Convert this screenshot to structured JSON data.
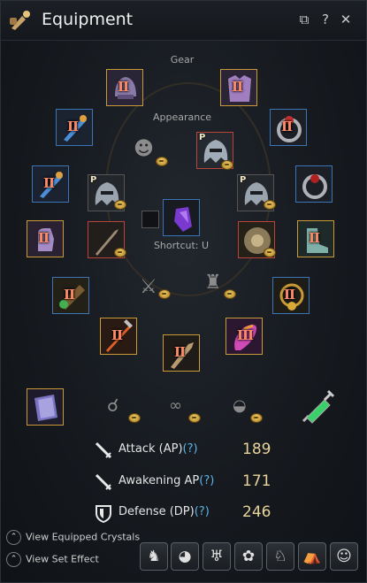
{
  "window": {
    "title": "Equipment",
    "icon": "potion-icon"
  },
  "titlebar_buttons": [
    {
      "name": "restore-icon",
      "glyph": "⧉"
    },
    {
      "name": "help-icon",
      "glyph": "?"
    },
    {
      "name": "close-icon",
      "glyph": "✕"
    }
  ],
  "labels": {
    "gear": "Gear",
    "appearance": "Appearance",
    "shortcut": "Shortcut: U"
  },
  "gear_slots": [
    {
      "id": "helmet",
      "enh": "II",
      "border": "gold"
    },
    {
      "id": "armor",
      "enh": "II",
      "border": "gold"
    },
    {
      "id": "earring-left",
      "enh": "II",
      "border": "blue"
    },
    {
      "id": "ring-right",
      "enh": "II",
      "border": "blue"
    },
    {
      "id": "earring-right",
      "enh": "II",
      "border": "blue"
    },
    {
      "id": "ring-left",
      "enh": "",
      "border": "blue"
    },
    {
      "id": "gloves",
      "enh": "II",
      "border": "gold"
    },
    {
      "id": "shoes",
      "enh": "II",
      "border": "gold"
    },
    {
      "id": "belt",
      "enh": "II",
      "border": "blue"
    },
    {
      "id": "necklace",
      "enh": "II",
      "border": "blue"
    },
    {
      "id": "main-weapon",
      "enh": "II",
      "border": "gold"
    },
    {
      "id": "sub-weapon",
      "enh": "III",
      "border": "gold"
    },
    {
      "id": "awakening-weapon",
      "enh": "II",
      "border": "gold"
    }
  ],
  "appearance_slots": [
    {
      "id": "costume-helmet",
      "mark": "P",
      "border": "red"
    },
    {
      "id": "costume-left",
      "mark": "P",
      "border": "none"
    },
    {
      "id": "costume-right",
      "mark": "P",
      "border": "none"
    },
    {
      "id": "costume-weapon",
      "mark": "",
      "border": "red"
    },
    {
      "id": "costume-shield",
      "mark": "",
      "border": "red"
    },
    {
      "id": "crystal",
      "mark": "",
      "border": "blue"
    }
  ],
  "accessories_row": [
    {
      "id": "tome",
      "border": "gold"
    }
  ],
  "stats": [
    {
      "id": "attack",
      "label": "Attack (AP)",
      "help": "(?)",
      "value": "189"
    },
    {
      "id": "awakening",
      "label": "Awakening AP",
      "help": "(?)",
      "value": "171"
    },
    {
      "id": "defense",
      "label": "Defense (DP)",
      "help": "(?)",
      "value": "246"
    }
  ],
  "footer": {
    "crystals": "View Equipped Crystals",
    "set_effect": "View Set Effect"
  },
  "toolbar": [
    {
      "name": "horse-button",
      "glyph": "♞"
    },
    {
      "name": "mask-button",
      "glyph": "◕"
    },
    {
      "name": "underwear-button",
      "glyph": "♅"
    },
    {
      "name": "pet-button",
      "glyph": "🐾"
    },
    {
      "name": "mount-costume-button",
      "glyph": "♘"
    },
    {
      "name": "tent-button",
      "glyph": "⛺"
    },
    {
      "name": "character-button",
      "glyph": "☺"
    }
  ]
}
